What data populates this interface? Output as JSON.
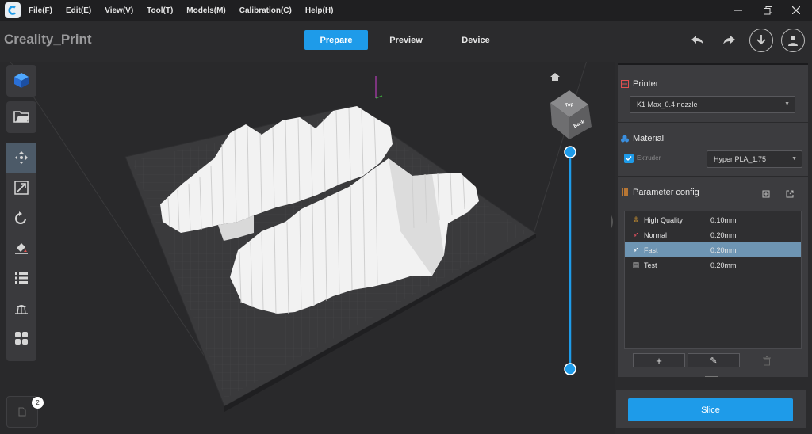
{
  "menubar": {
    "items": [
      "File(F)",
      "Edit(E)",
      "View(V)",
      "Tool(T)",
      "Models(M)",
      "Calibration(C)",
      "Help(H)"
    ]
  },
  "window_controls": [
    "minimize",
    "restore",
    "close"
  ],
  "header": {
    "app_title": "Creality_Print",
    "tabs": [
      {
        "label": "Prepare",
        "active": true
      },
      {
        "label": "Preview",
        "active": false
      },
      {
        "label": "Device",
        "active": false
      }
    ]
  },
  "viewcube": {
    "face_top": "Top",
    "face_front": "Back"
  },
  "left_toolbar": {
    "top": [
      "add-model-icon"
    ],
    "second": [
      "open-file-icon"
    ],
    "group": [
      "move-icon",
      "scale-icon",
      "rotate-icon",
      "lay-flat-icon",
      "list-icon",
      "support-icon",
      "arrange-icon"
    ]
  },
  "object_list_badge": "2",
  "printer": {
    "section_label": "Printer",
    "selected": "K1 Max_0.4 nozzle"
  },
  "material": {
    "section_label": "Material",
    "extruder_label": "Extruder",
    "extruder_checked": true,
    "selected": "Hyper PLA_1.75"
  },
  "parameter_config": {
    "section_label": "Parameter config",
    "profiles": [
      {
        "icon": "crown-icon",
        "name": "High Quality",
        "value": "0.10mm",
        "selected": false
      },
      {
        "icon": "rocket-icon",
        "name": "Normal",
        "value": "0.20mm",
        "selected": false
      },
      {
        "icon": "rocket-icon",
        "name": "Fast",
        "value": "0.20mm",
        "selected": true
      },
      {
        "icon": "file-icon",
        "name": "Test",
        "value": "0.20mm",
        "selected": false
      }
    ],
    "add_label": "+",
    "edit_label": "✎"
  },
  "slice_button": "Slice",
  "colors": {
    "accent": "#1e9be9",
    "panel": "#3c3c3f",
    "background": "#2b2b2d",
    "selected_row": "#6e95b3"
  }
}
